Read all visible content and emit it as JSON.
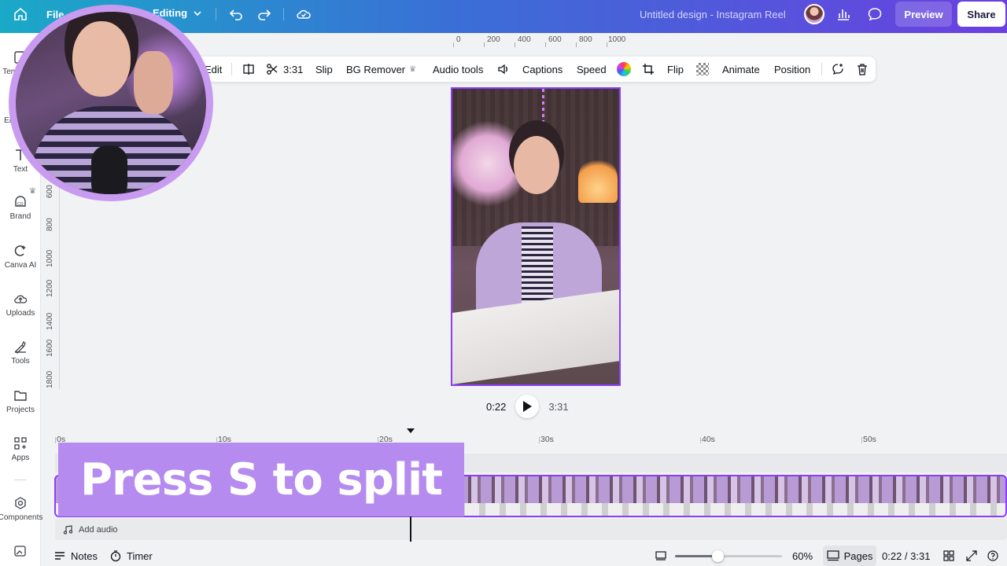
{
  "topbar": {
    "file_label": "File",
    "editing_label": "Editing",
    "design_title": "Untitled design - Instagram Reel",
    "preview_label": "Preview",
    "share_label": "Share",
    "gradient_start": "#1aa9c7",
    "gradient_end": "#6b3fe0"
  },
  "sidebar": {
    "items": [
      {
        "label": "Templates",
        "icon": "templates-icon"
      },
      {
        "label": "Elements",
        "icon": "elements-icon"
      },
      {
        "label": "Text",
        "icon": "text-icon"
      },
      {
        "label": "Brand",
        "icon": "brand-icon"
      },
      {
        "label": "Canva AI",
        "icon": "canva-ai-icon"
      },
      {
        "label": "Uploads",
        "icon": "uploads-icon"
      },
      {
        "label": "Tools",
        "icon": "tools-icon"
      },
      {
        "label": "Projects",
        "icon": "projects-icon"
      },
      {
        "label": "Apps",
        "icon": "apps-icon"
      },
      {
        "label": "Components",
        "icon": "components-icon"
      }
    ]
  },
  "rulers": {
    "top": [
      "0",
      "200",
      "400",
      "600",
      "800",
      "1000"
    ],
    "left": [
      "600",
      "800",
      "1000",
      "1200",
      "1400",
      "1600",
      "1800"
    ]
  },
  "context_toolbar": {
    "edit_label": "Edit",
    "split_time": "3:31",
    "slip_label": "Slip",
    "bg_remover_label": "BG Remover",
    "audio_tools_label": "Audio tools",
    "captions_label": "Captions",
    "speed_label": "Speed",
    "flip_label": "Flip",
    "animate_label": "Animate",
    "position_label": "Position"
  },
  "player": {
    "current_time": "0:22",
    "duration": "3:31"
  },
  "timeline": {
    "ticks": [
      "0s",
      "10s",
      "20s",
      "30s",
      "40s",
      "50s"
    ],
    "add_audio_label": "Add audio",
    "accent_color": "#8b3dff"
  },
  "overlay": {
    "caption_text": "Press S to split",
    "caption_bg": "#b58bf0"
  },
  "bottombar": {
    "notes_label": "Notes",
    "timer_label": "Timer",
    "zoom_value": "60%",
    "zoom_fraction": 0.4,
    "pages_label": "Pages",
    "time_readout": "0:22 / 3:31"
  }
}
